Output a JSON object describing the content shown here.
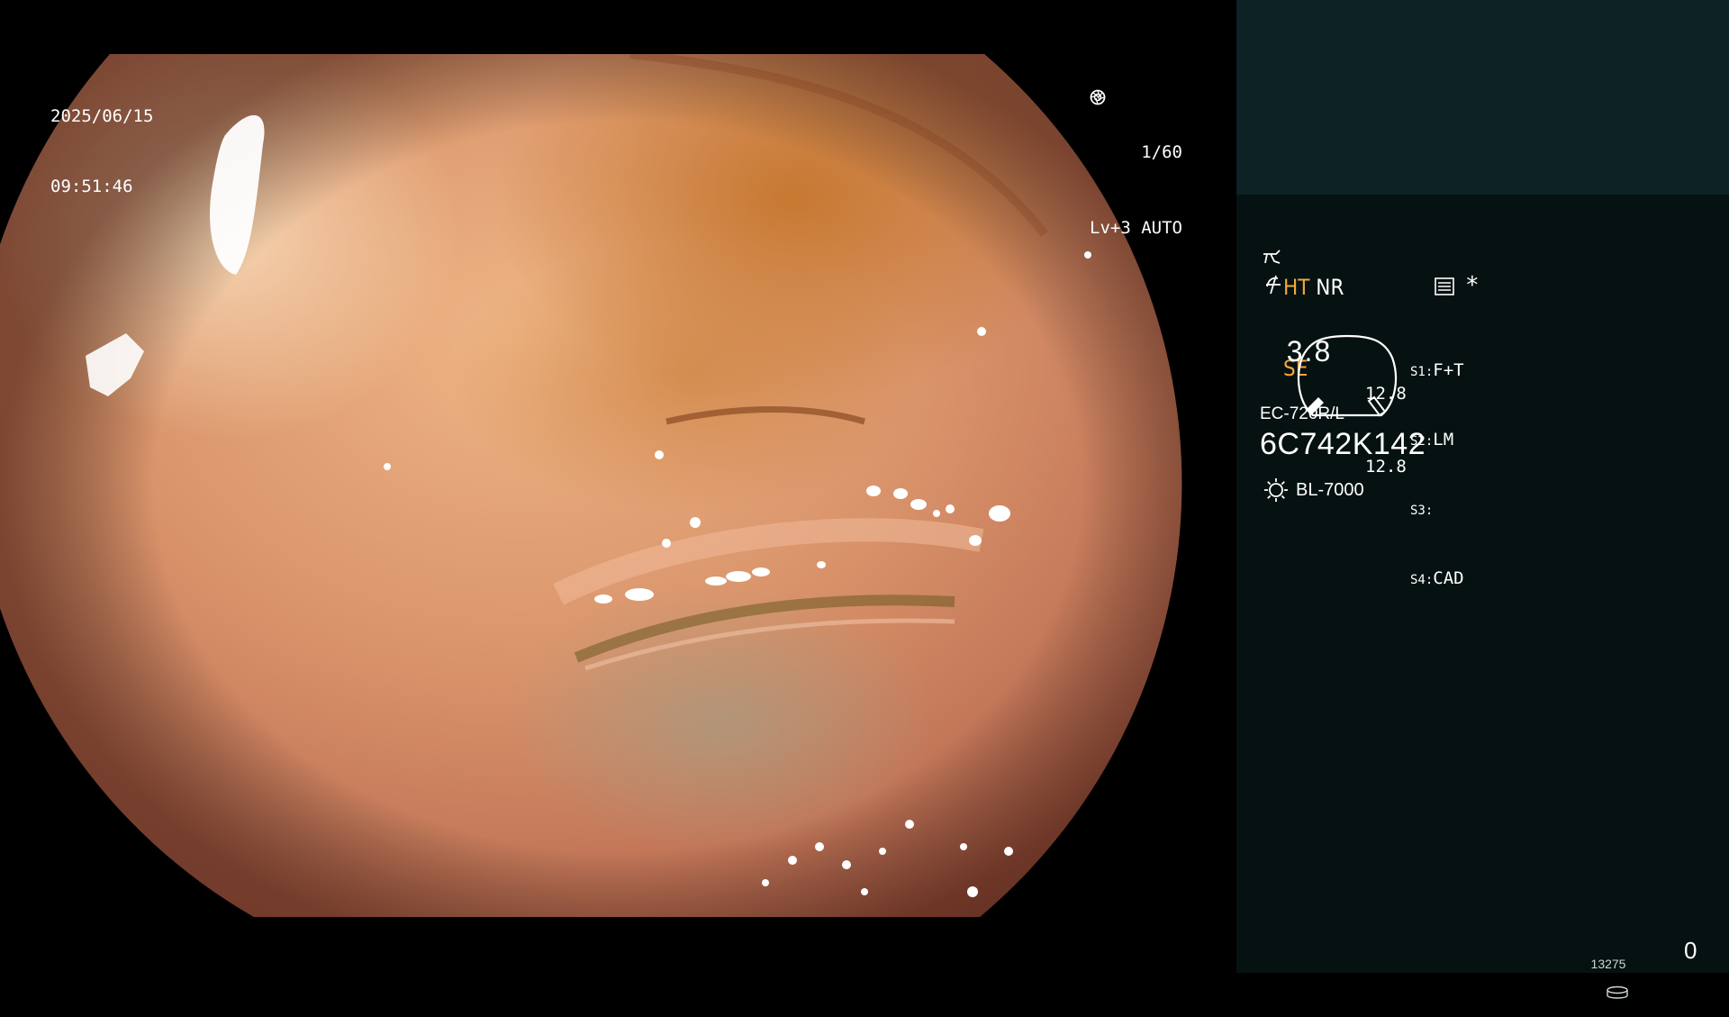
{
  "osd": {
    "date": "2025/06/15",
    "time": "09:51:46",
    "shutter": "1/60",
    "shutter_icon": "aperture-icon",
    "iris": "Lv+3 AUTO",
    "iris_icon": "auto-iris-icon"
  },
  "panel": {
    "mode_ht": "HT",
    "mode_nr": "NR",
    "mode_se": "SE",
    "gauge_value": "3.8",
    "gauge_sub_top": "12.8",
    "gauge_sub_bottom": "12.8",
    "switches": [
      {
        "key": "S1:",
        "value": "F+T"
      },
      {
        "key": "S2:",
        "value": "LM"
      },
      {
        "key": "S3:",
        "value": ""
      },
      {
        "key": "S4:",
        "value": "CAD"
      }
    ],
    "scope_model": "EC-720R/L",
    "scope_serial": "6C742K142",
    "light_source": "BL-7000",
    "storage_count": "13275",
    "capture_counter": "0"
  },
  "colors": {
    "panel_bg": "#061112",
    "panel_top_bg": "#0c2224",
    "mode_accent": "#f2a73c"
  }
}
